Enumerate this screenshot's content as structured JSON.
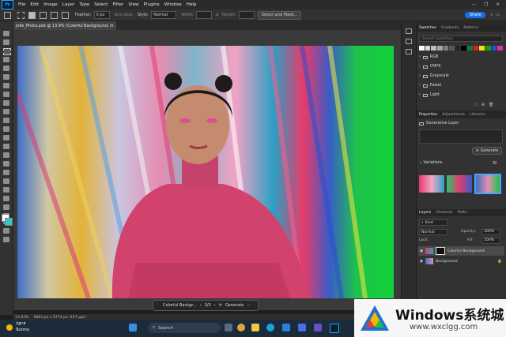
{
  "menubar": {
    "app_badge": "Ps",
    "items": [
      "File",
      "Edit",
      "Image",
      "Layer",
      "Type",
      "Select",
      "Filter",
      "View",
      "Plugins",
      "Window",
      "Help"
    ],
    "minimize": "—",
    "maximize": "❐",
    "close": "✕"
  },
  "options": {
    "feather_label": "Feather:",
    "feather_value": "0 px",
    "antialias_label": "Anti-alias",
    "style_label": "Style:",
    "style_value": "Normal",
    "width_label": "Width:",
    "height_label": "Height:",
    "select_mask": "Select and Mask...",
    "share": "Share"
  },
  "document": {
    "tab_title": "Jolie_Photo.psd @ 13.9% (Colorful Background, RGB/8) *",
    "close": "×"
  },
  "status": {
    "zoom": "13.93%",
    "info": "9663 px x 5774 px (157 ppi)"
  },
  "contextual_bar": {
    "layer_name": "Colorful Backgr...",
    "page": "3/3",
    "generate": "Generate"
  },
  "swatches": {
    "tabs": [
      "Swatches",
      "Gradients",
      "Patterns"
    ],
    "search_placeholder": "Search Swatches",
    "folders": [
      "RGB",
      "CMYK",
      "Grayscale",
      "Pastel",
      "Light"
    ],
    "colors": [
      "#ffffff",
      "#d9d9d9",
      "#bfbfbf",
      "#a6a6a6",
      "#7f7f7f",
      "#595959",
      "#262626",
      "#000000",
      "#0a7f3f",
      "#e02020",
      "#f0e010",
      "#10a010",
      "#2050e0",
      "#e030a0"
    ]
  },
  "properties": {
    "tabs": [
      "Properties",
      "Adjustments",
      "Libraries"
    ],
    "layer_type": "Generative Layer",
    "generate": "Generate",
    "variations": "Variations"
  },
  "layers": {
    "tabs": [
      "Layers",
      "Channels",
      "Paths"
    ],
    "kind": "Kind",
    "blend": "Normal",
    "opacity_label": "Opacity:",
    "opacity": "100%",
    "lock_label": "Lock:",
    "fill_label": "Fill:",
    "fill": "100%",
    "items": [
      {
        "name": "Colorful Background"
      },
      {
        "name": "Background"
      }
    ]
  },
  "taskbar": {
    "temp": "78°F",
    "condition": "Sunny",
    "search": "Search"
  },
  "watermark": {
    "title": "Windows系统城",
    "url": "www.wxclgg.com"
  }
}
